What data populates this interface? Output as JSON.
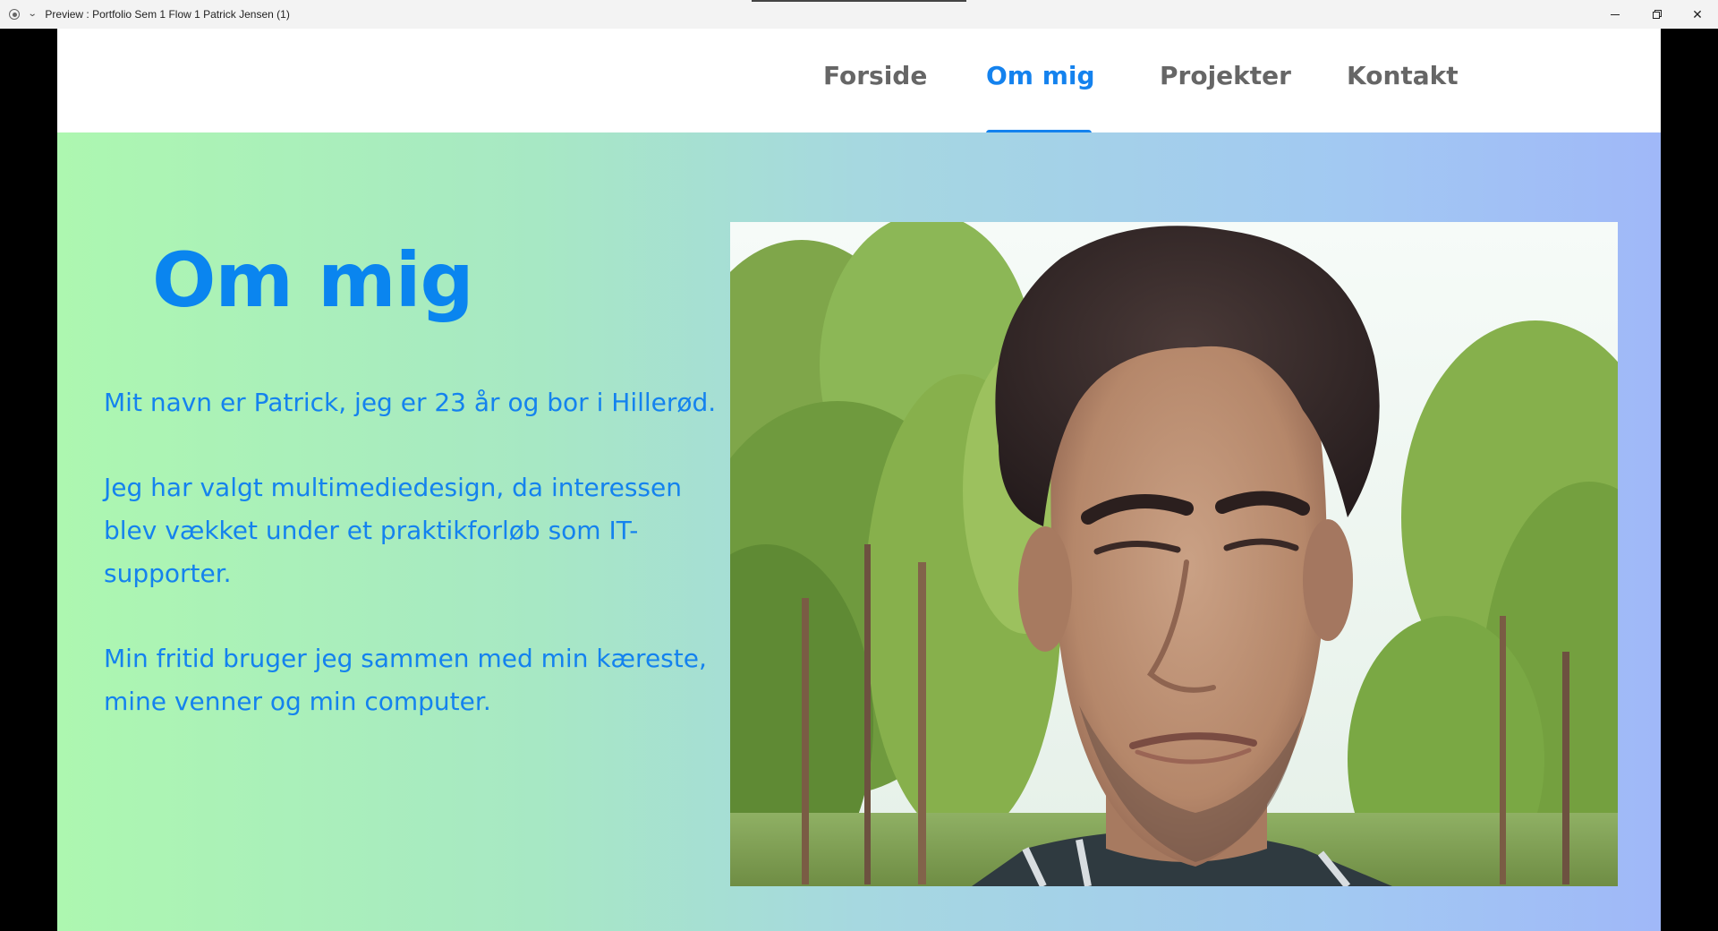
{
  "window": {
    "title": "Preview : Portfolio Sem 1 Flow 1 Patrick Jensen (1)",
    "controls": {
      "minimize_icon": "minimize-icon",
      "restore_icon": "restore-icon",
      "close_label": "✕"
    }
  },
  "nav": {
    "items": [
      {
        "label": "Forside",
        "active": false
      },
      {
        "label": "Om mig",
        "active": true
      },
      {
        "label": "Projekter",
        "active": false
      },
      {
        "label": "Kontakt",
        "active": false
      }
    ],
    "active_color": "#1482ee",
    "inactive_color": "#666666"
  },
  "about": {
    "heading": "Om mig",
    "paragraph1": "Mit navn er Patrick,  jeg er 23 år og bor i Hillerød.",
    "paragraph2": "Jeg har valgt multimediedesign, da interessen blev vækket under et praktikforløb som IT-supporter.",
    "paragraph3": "Min fritid bruger jeg sammen med min kæreste, mine venner og min computer.",
    "text_color": "#1482ee",
    "gradient_start": "#adf7b0",
    "gradient_end": "#a0b8f8"
  },
  "photo": {
    "subject": "portrait-photo"
  }
}
